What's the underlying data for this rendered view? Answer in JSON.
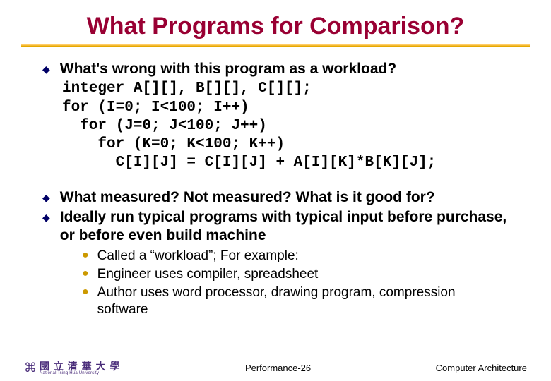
{
  "title": "What Programs for Comparison?",
  "bullets": [
    {
      "text": "What's wrong with this program as a workload?",
      "code": "integer A[][], B[][], C[][];\nfor (I=0; I<100; I++)\n  for (J=0; J<100; J++)\n    for (K=0; K<100; K++)\n      C[I][J] = C[I][J] + A[I][K]*B[K][J];"
    },
    {
      "text": "What measured? Not measured? What is it good for?"
    },
    {
      "text": "Ideally run typical programs with typical input before purchase, or before even build machine",
      "subs": [
        "Called a “workload”; For example:",
        "Engineer uses compiler, spreadsheet",
        "Author uses word processor, drawing program, compression software"
      ]
    }
  ],
  "footer": {
    "logo_cn": "國 立 清 華 大 學",
    "logo_en": "National Tsing Hua University",
    "center": "Performance-26",
    "right": "Computer Architecture"
  }
}
